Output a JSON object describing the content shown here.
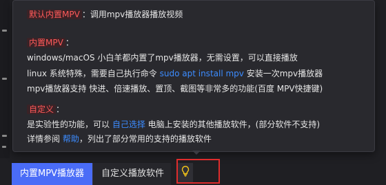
{
  "tooltip": {
    "line1": {
      "tag": "默认内置MPV",
      "text": "：调用mpv播放器播放视频"
    },
    "builtin": {
      "heading": "内置MPV",
      "heading_suffix": "：",
      "line1": "windows/macOS 小白羊都内置了mpv播放器，无需设置，可以直接播放",
      "line2_before": "linux 系统特殊，需要自己执行命令 ",
      "line2_link": "sudo apt install mpv",
      "line2_after": " 安装一次mpv播放器",
      "line3": "mpv播放器支持 快进、倍速播放、置顶、截图等非常多的功能(百度 MPV快捷键)"
    },
    "custom": {
      "heading": "自定义",
      "heading_suffix": "：",
      "line1_before": "是实验性的功能，可以 ",
      "line1_link": "自己选择",
      "line1_after": " 电脑上安装的其他播放软件，(部分软件不支持)",
      "line2_before": "详情参阅 ",
      "line2_link": "帮助",
      "line2_after": "，列出了部分常用的支持的播放软件"
    }
  },
  "tabs": [
    {
      "label": "内置MPV播放器",
      "active": true
    },
    {
      "label": "自定义播放软件",
      "active": false
    }
  ],
  "colors": {
    "accent": "#4a6cf7",
    "tag_red": "#ff5a5a",
    "link_blue": "#3c8cff",
    "highlight_border": "#e02c2c"
  },
  "icons": {
    "hint": "lightbulb-icon"
  }
}
